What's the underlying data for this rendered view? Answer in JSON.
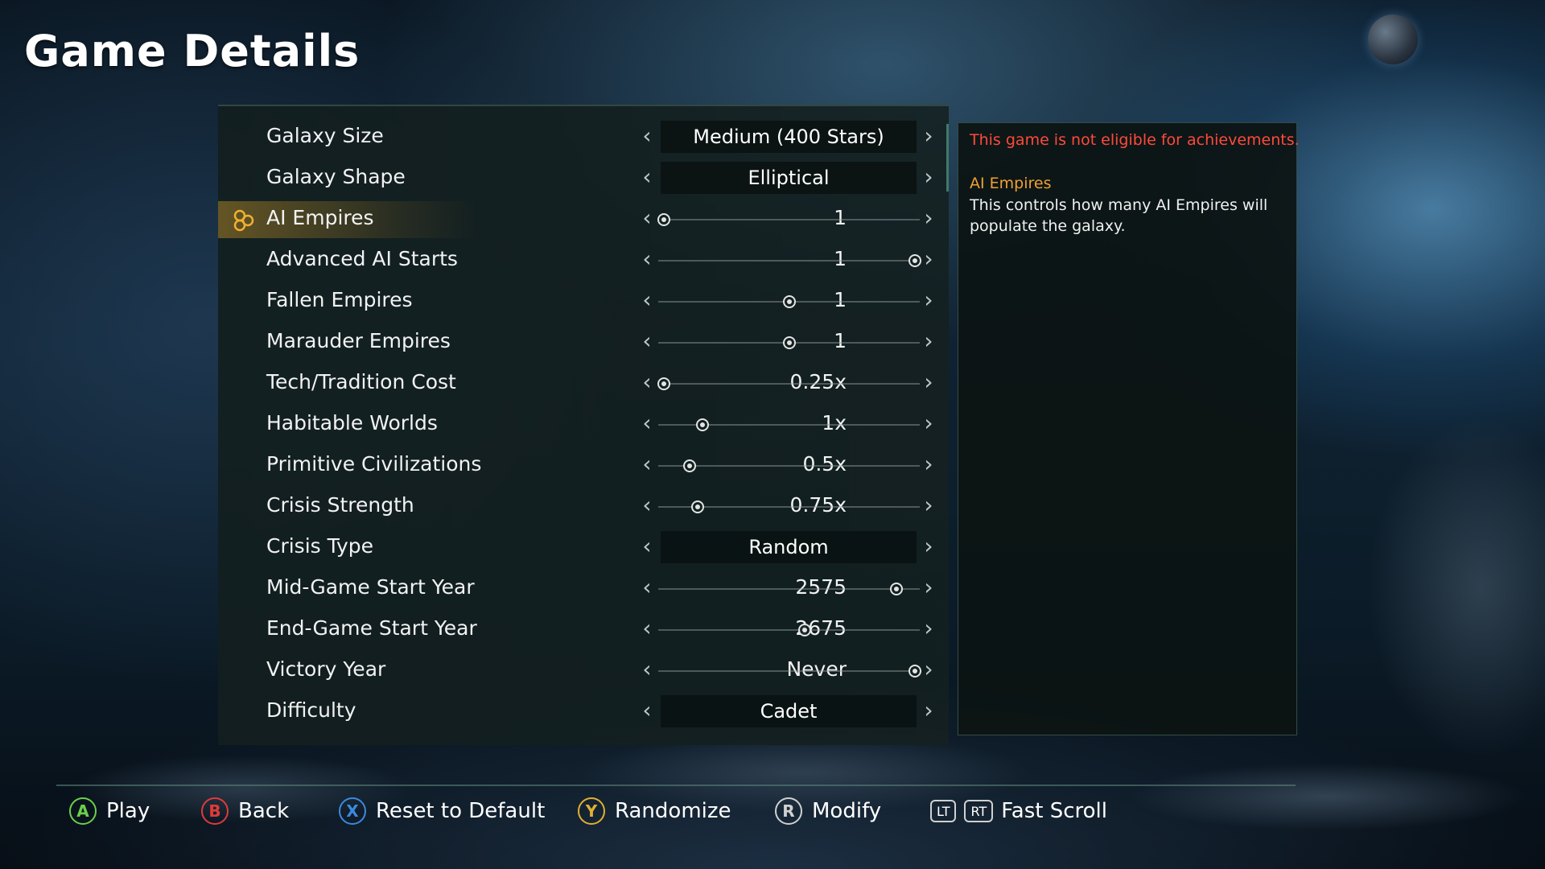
{
  "page_title": "Game Details",
  "settings": [
    {
      "label": "Galaxy Size",
      "kind": "select",
      "value": "Medium (400 Stars)"
    },
    {
      "label": "Galaxy Shape",
      "kind": "select",
      "value": "Elliptical"
    },
    {
      "label": "AI Empires",
      "kind": "slider",
      "value": "1",
      "level": 0.02,
      "selected": true
    },
    {
      "label": "Advanced AI Starts",
      "kind": "slider",
      "value": "1",
      "level": 0.98
    },
    {
      "label": "Fallen Empires",
      "kind": "slider",
      "value": "1",
      "level": 0.5
    },
    {
      "label": "Marauder Empires",
      "kind": "slider",
      "value": "1",
      "level": 0.5
    },
    {
      "label": "Tech/Tradition Cost",
      "kind": "slider",
      "value": "0.25x",
      "level": 0.02
    },
    {
      "label": "Habitable Worlds",
      "kind": "slider",
      "value": "1x",
      "level": 0.17
    },
    {
      "label": "Primitive Civilizations",
      "kind": "slider",
      "value": "0.5x",
      "level": 0.12
    },
    {
      "label": "Crisis Strength",
      "kind": "slider",
      "value": "0.75x",
      "level": 0.15
    },
    {
      "label": "Crisis Type",
      "kind": "select",
      "value": "Random"
    },
    {
      "label": "Mid-Game Start Year",
      "kind": "slider",
      "value": "2575",
      "level": 0.91
    },
    {
      "label": "End-Game Start Year",
      "kind": "slider",
      "value": "2675",
      "level": 0.56
    },
    {
      "label": "Victory Year",
      "kind": "slider",
      "value": "Never",
      "level": 0.98
    },
    {
      "label": "Difficulty",
      "kind": "select",
      "value": "Cadet"
    }
  ],
  "info": {
    "warning": "This game is not eligible for achievements.",
    "heading": "AI Empires",
    "text": "This controls how many AI Empires will populate the galaxy."
  },
  "footer": {
    "play": {
      "glyph": "A",
      "label": "Play",
      "color": "#6ad04a"
    },
    "back": {
      "glyph": "B",
      "label": "Back",
      "color": "#e03a3a"
    },
    "reset": {
      "glyph": "X",
      "label": "Reset to Default",
      "color": "#3a8ae0"
    },
    "randomize": {
      "glyph": "Y",
      "label": "Randomize",
      "color": "#e0b030"
    },
    "modify": {
      "glyph": "R",
      "label": "Modify",
      "color": "#d0d0d0"
    },
    "fast_scroll": {
      "glyph_left": "LT",
      "glyph_right": "RT",
      "label": "Fast Scroll"
    }
  },
  "icons": {
    "arrow_left": "chevron-left-icon",
    "arrow_right": "chevron-right-icon",
    "selection": "hex-selection-icon"
  }
}
